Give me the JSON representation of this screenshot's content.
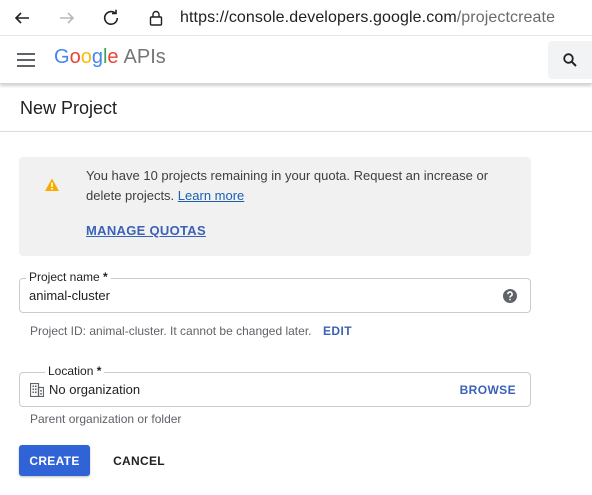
{
  "browser": {
    "url_host": "https://console.developers.google.com",
    "url_path": "/projectcreate"
  },
  "header": {
    "logo_letters": [
      "G",
      "o",
      "o",
      "g",
      "l",
      "e"
    ],
    "logo_suffix": "APIs"
  },
  "page": {
    "title": "New Project"
  },
  "notice": {
    "text": "You have 10 projects remaining in your quota. Request an increase or delete projects.",
    "learn_more": "Learn more",
    "manage_quotas": "MANAGE QUOTAS"
  },
  "project_name": {
    "label": "Project name",
    "required_mark": " *",
    "value": "animal-cluster",
    "hint": "Project ID: animal-cluster. It cannot be changed later.",
    "edit_label": "EDIT"
  },
  "location": {
    "label": "Location",
    "required_mark": " *",
    "value": "No organization",
    "browse_label": "BROWSE",
    "hint": "Parent organization or folder"
  },
  "actions": {
    "create_label": "CREATE",
    "cancel_label": "CANCEL"
  },
  "colors": {
    "google_blue": "#4285F4",
    "google_red": "#EA4335",
    "google_yellow": "#FBBC05",
    "google_green": "#34A853",
    "primary_button": "#2f63d6",
    "link": "#3b62b8",
    "warning": "#f9ab00"
  },
  "icons": [
    "back-arrow-icon",
    "forward-arrow-icon",
    "reload-icon",
    "lock-icon",
    "menu-icon",
    "search-icon",
    "warning-icon",
    "help-icon",
    "organization-icon"
  ]
}
